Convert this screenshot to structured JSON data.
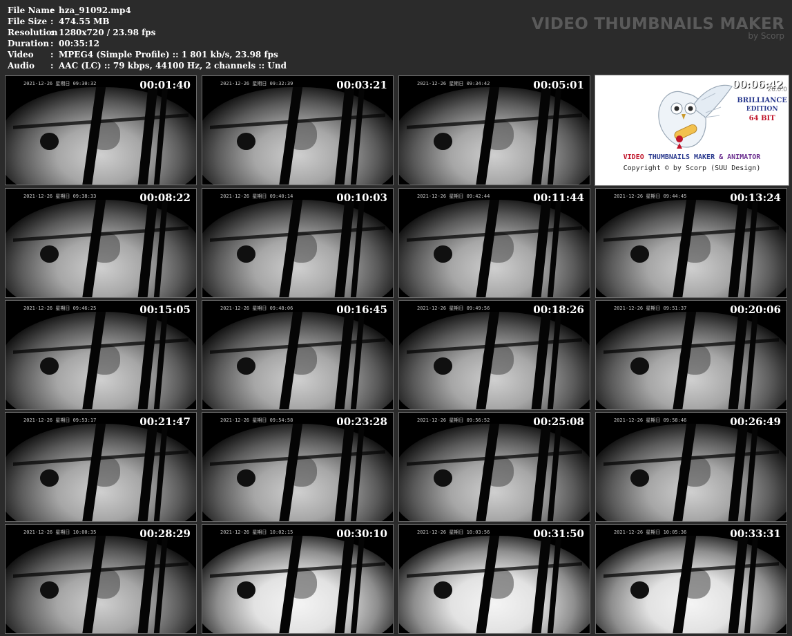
{
  "header": {
    "fields": [
      {
        "key": "File Name",
        "value": "hza_91092.mp4"
      },
      {
        "key": "File Size",
        "value": "474.55 MB"
      },
      {
        "key": "Resolution",
        "value": "1280x720 / 23.98 fps"
      },
      {
        "key": "Duration",
        "value": "00:35:12"
      },
      {
        "key": "Video",
        "value": "MPEG4 (Simple Profile) :: 1 801 kb/s, 23.98 fps"
      },
      {
        "key": "Audio",
        "value": "AAC (LC) :: 79 kbps, 44100 Hz, 2 channels :: Und"
      }
    ],
    "separator": ":",
    "brand_title": "VIDEO THUMBNAILS MAKER",
    "brand_by": "by Scorp"
  },
  "logo_card": {
    "timestamp": "00:06:42",
    "version": "26.0.0",
    "edition_line1": "BRILLIANCE",
    "edition_line2": "EDITION",
    "edition_line3": "64 BIT",
    "product_part1": "VIDEO ",
    "product_part2": "THUMBNAILS MAKER ",
    "product_part3": "& ANIMATOR",
    "copyright": "Copyright © by Scorp (SUU Design)"
  },
  "thumbnails": [
    {
      "timestamp": "00:01:40",
      "osd": "2021-12-26 星期日 09:30:32"
    },
    {
      "timestamp": "00:03:21",
      "osd": "2021-12-26 星期日 09:32:39"
    },
    {
      "timestamp": "00:05:01",
      "osd": "2021-12-26 星期日 09:34:42"
    },
    {
      "timestamp": "00:08:22",
      "osd": "2021-12-26 星期日 09:38:33"
    },
    {
      "timestamp": "00:10:03",
      "osd": "2021-12-26 星期日 09:40:14"
    },
    {
      "timestamp": "00:11:44",
      "osd": "2021-12-26 星期日 09:42:44"
    },
    {
      "timestamp": "00:13:24",
      "osd": "2021-12-26 星期日 09:44:45"
    },
    {
      "timestamp": "00:15:05",
      "osd": "2021-12-26 星期日 09:46:25"
    },
    {
      "timestamp": "00:16:45",
      "osd": "2021-12-26 星期日 09:48:06"
    },
    {
      "timestamp": "00:18:26",
      "osd": "2021-12-26 星期日 09:49:56"
    },
    {
      "timestamp": "00:20:06",
      "osd": "2021-12-26 星期日 09:51:37"
    },
    {
      "timestamp": "00:21:47",
      "osd": "2021-12-26 星期日 09:53:17"
    },
    {
      "timestamp": "00:23:28",
      "osd": "2021-12-26 星期日 09:54:58"
    },
    {
      "timestamp": "00:25:08",
      "osd": "2021-12-26 星期日 09:56:52"
    },
    {
      "timestamp": "00:26:49",
      "osd": "2021-12-26 星期日 09:58:46"
    },
    {
      "timestamp": "00:28:29",
      "osd": "2021-12-26 星期日 10:00:35"
    },
    {
      "timestamp": "00:30:10",
      "osd": "2021-12-26 星期日 10:02:15"
    },
    {
      "timestamp": "00:31:50",
      "osd": "2021-12-26 星期日 10:03:56"
    },
    {
      "timestamp": "00:33:31",
      "osd": "2021-12-26 星期日 10:05:36"
    }
  ]
}
